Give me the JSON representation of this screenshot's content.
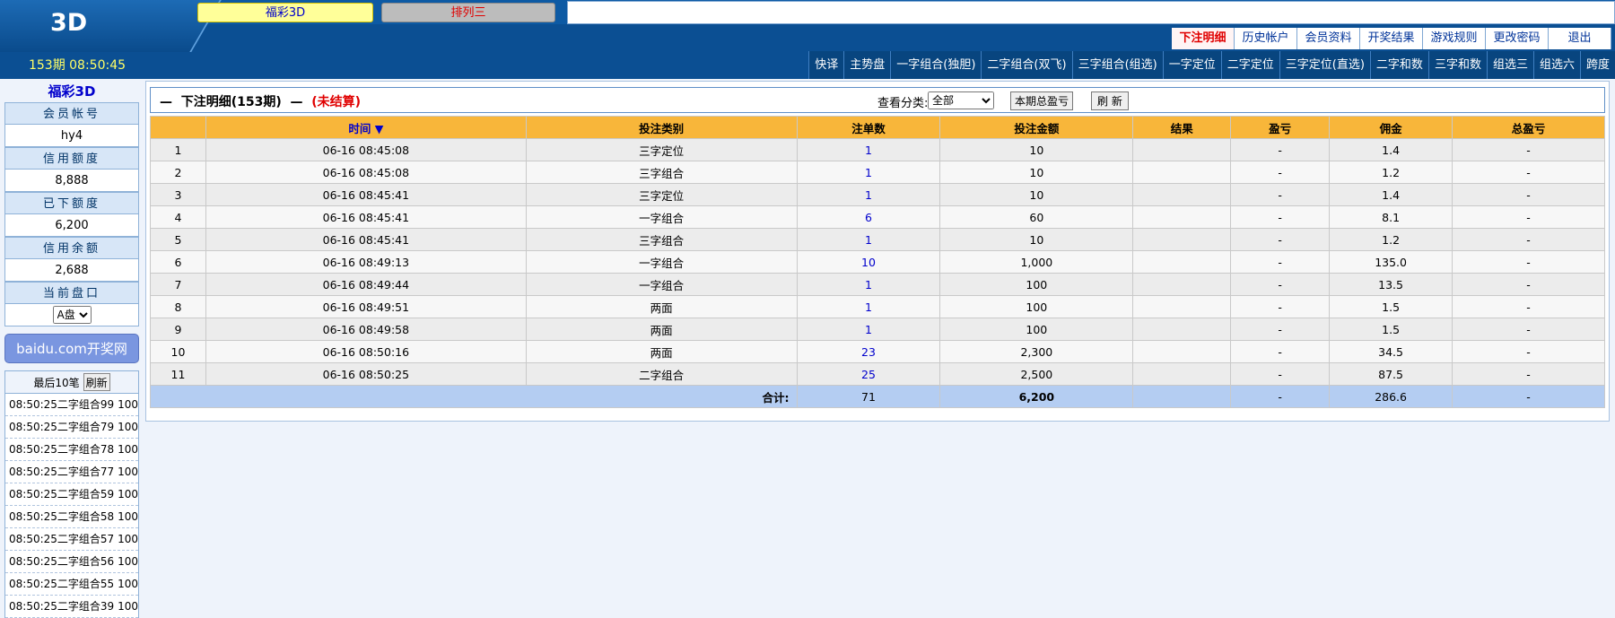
{
  "header": {
    "logo": "3D",
    "game_tabs": [
      "福彩3D",
      "排列三"
    ],
    "period_clock": "153期 08:50:45",
    "menu_top": [
      "下注明细",
      "历史帐户",
      "会员资料",
      "开奖结果",
      "游戏规则",
      "更改密码",
      "退出"
    ],
    "menu_bottom": [
      "快译",
      "主势盘",
      "一字组合(独胆)",
      "二字组合(双飞)",
      "三字组合(组选)",
      "一字定位",
      "二字定位",
      "三字定位(直选)",
      "二字和数",
      "三字和数",
      "组选三",
      "组选六",
      "跨度"
    ]
  },
  "sidebar": {
    "title": "福彩3D",
    "fields": [
      {
        "label": "会员帐号",
        "value": "hy4"
      },
      {
        "label": "信用额度",
        "value": "8,888"
      },
      {
        "label": "已下额度",
        "value": "6,200"
      },
      {
        "label": "信用余额",
        "value": "2,688"
      }
    ],
    "market_label": "当前盘口",
    "market_value": "A盘",
    "baidu_button": "baidu.com开奖网",
    "recent_title": "最后10笔",
    "recent_refresh": "刷新",
    "recent": [
      {
        "time": "08:50:25",
        "name": "二字组合99",
        "amount": "100"
      },
      {
        "time": "08:50:25",
        "name": "二字组合79",
        "amount": "100"
      },
      {
        "time": "08:50:25",
        "name": "二字组合78",
        "amount": "100"
      },
      {
        "time": "08:50:25",
        "name": "二字组合77",
        "amount": "100"
      },
      {
        "time": "08:50:25",
        "name": "二字组合59",
        "amount": "100"
      },
      {
        "time": "08:50:25",
        "name": "二字组合58",
        "amount": "100"
      },
      {
        "time": "08:50:25",
        "name": "二字组合57",
        "amount": "100"
      },
      {
        "time": "08:50:25",
        "name": "二字组合56",
        "amount": "100"
      },
      {
        "time": "08:50:25",
        "name": "二字组合55",
        "amount": "100"
      },
      {
        "time": "08:50:25",
        "name": "二字组合39",
        "amount": "100"
      }
    ]
  },
  "main": {
    "title_dash_left": "—",
    "title": "下注明细(153期)",
    "title_dash_right": "—",
    "status": "(未结算)",
    "filter_label": "查看分类:",
    "filter_value": "全部",
    "btn_total": "本期总盈亏",
    "btn_refresh": "刷 新",
    "columns": [
      "",
      "时间 ▼",
      "投注类别",
      "注单数",
      "投注金额",
      "结果",
      "盈亏",
      "佣金",
      "总盈亏"
    ],
    "rows": [
      {
        "no": "1",
        "time": "06-16 08:45:08",
        "type": "三字定位",
        "count": "1",
        "amount": "10",
        "result": "",
        "pl": "-",
        "commission": "1.4",
        "total": "-"
      },
      {
        "no": "2",
        "time": "06-16 08:45:08",
        "type": "三字组合",
        "count": "1",
        "amount": "10",
        "result": "",
        "pl": "-",
        "commission": "1.2",
        "total": "-"
      },
      {
        "no": "3",
        "time": "06-16 08:45:41",
        "type": "三字定位",
        "count": "1",
        "amount": "10",
        "result": "",
        "pl": "-",
        "commission": "1.4",
        "total": "-"
      },
      {
        "no": "4",
        "time": "06-16 08:45:41",
        "type": "一字组合",
        "count": "6",
        "amount": "60",
        "result": "",
        "pl": "-",
        "commission": "8.1",
        "total": "-"
      },
      {
        "no": "5",
        "time": "06-16 08:45:41",
        "type": "三字组合",
        "count": "1",
        "amount": "10",
        "result": "",
        "pl": "-",
        "commission": "1.2",
        "total": "-"
      },
      {
        "no": "6",
        "time": "06-16 08:49:13",
        "type": "一字组合",
        "count": "10",
        "amount": "1,000",
        "result": "",
        "pl": "-",
        "commission": "135.0",
        "total": "-"
      },
      {
        "no": "7",
        "time": "06-16 08:49:44",
        "type": "一字组合",
        "count": "1",
        "amount": "100",
        "result": "",
        "pl": "-",
        "commission": "13.5",
        "total": "-"
      },
      {
        "no": "8",
        "time": "06-16 08:49:51",
        "type": "两面",
        "count": "1",
        "amount": "100",
        "result": "",
        "pl": "-",
        "commission": "1.5",
        "total": "-"
      },
      {
        "no": "9",
        "time": "06-16 08:49:58",
        "type": "两面",
        "count": "1",
        "amount": "100",
        "result": "",
        "pl": "-",
        "commission": "1.5",
        "total": "-"
      },
      {
        "no": "10",
        "time": "06-16 08:50:16",
        "type": "两面",
        "count": "23",
        "amount": "2,300",
        "result": "",
        "pl": "-",
        "commission": "34.5",
        "total": "-"
      },
      {
        "no": "11",
        "time": "06-16 08:50:25",
        "type": "二字组合",
        "count": "25",
        "amount": "2,500",
        "result": "",
        "pl": "-",
        "commission": "87.5",
        "total": "-"
      }
    ],
    "totals": {
      "label": "合计:",
      "count": "71",
      "amount": "6,200",
      "result": "",
      "pl": "-",
      "commission": "286.6",
      "total": "-"
    }
  }
}
